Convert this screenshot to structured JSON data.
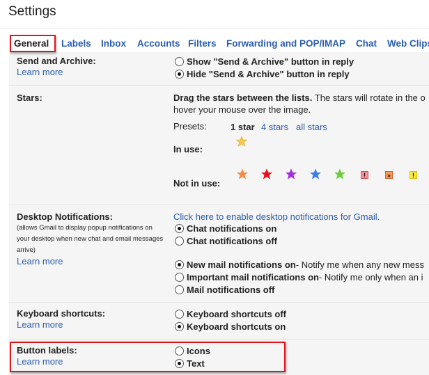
{
  "header": {
    "title": "Settings"
  },
  "tabs": [
    {
      "label": "General",
      "active": true
    },
    {
      "label": "Labels"
    },
    {
      "label": "Inbox"
    },
    {
      "label": "Accounts"
    },
    {
      "label": "Filters"
    },
    {
      "label": "Forwarding and POP/IMAP"
    },
    {
      "label": "Chat"
    },
    {
      "label": "Web Clips"
    }
  ],
  "common": {
    "learn_more": "Learn more"
  },
  "send_archive": {
    "label": "Send and Archive:",
    "options": [
      {
        "label": "Show \"Send & Archive\" button in reply",
        "checked": false
      },
      {
        "label": "Hide \"Send & Archive\" button in reply",
        "checked": true
      }
    ]
  },
  "stars": {
    "label": "Stars:",
    "instruction_bold": "Drag the stars between the lists.",
    "instruction_rest": " The stars will rotate in the o",
    "instruction_line2": "hover your mouse over the image.",
    "presets_label": "Presets:",
    "presets": [
      {
        "label": "1 star",
        "selected": true
      },
      {
        "label": "4 stars"
      },
      {
        "label": "all stars"
      }
    ],
    "in_use_label": "In use:",
    "in_use": [
      {
        "name": "yellow-star",
        "color": "#f7c948"
      }
    ],
    "not_in_use_label": "Not in use:",
    "not_in_use": [
      {
        "name": "orange-star",
        "type": "star",
        "color": "#f68b45"
      },
      {
        "name": "red-star",
        "type": "star",
        "color": "#e8101a"
      },
      {
        "name": "purple-star",
        "type": "star",
        "color": "#a22ce0"
      },
      {
        "name": "blue-star",
        "type": "star",
        "color": "#3d7ee5"
      },
      {
        "name": "green-star",
        "type": "star",
        "color": "#6ccc3c"
      },
      {
        "name": "red-bang",
        "type": "box",
        "glyph": "!",
        "color": "#f59096",
        "border": "#d9545c"
      },
      {
        "name": "orange-guillemet",
        "type": "box",
        "glyph": "»",
        "color": "#f89a5c",
        "border": "#d0642a"
      },
      {
        "name": "yellow-bang",
        "type": "box",
        "glyph": "!",
        "color": "#fbe83a",
        "border": "#d4c21a"
      }
    ]
  },
  "desktop_notifications": {
    "label": "Desktop Notifications:",
    "description": "(allows Gmail to display popup notifications on your desktop when new chat and email messages arrive)",
    "enable_link": "Click here to enable desktop notifications for Gmail.",
    "chat_options": [
      {
        "label": "Chat notifications on",
        "checked": true
      },
      {
        "label": "Chat notifications off",
        "checked": false
      }
    ],
    "mail_options": [
      {
        "label": "New mail notifications on",
        "desc": " - Notify me when any new mess",
        "checked": true
      },
      {
        "label": "Important mail notifications on",
        "desc": " - Notify me only when an i",
        "checked": false
      },
      {
        "label": "Mail notifications off",
        "desc": "",
        "checked": false
      }
    ]
  },
  "keyboard_shortcuts": {
    "label": "Keyboard shortcuts:",
    "options": [
      {
        "label": "Keyboard shortcuts off",
        "checked": false
      },
      {
        "label": "Keyboard shortcuts on",
        "checked": true
      }
    ]
  },
  "button_labels": {
    "label": "Button labels:",
    "options": [
      {
        "label": "Icons",
        "checked": false
      },
      {
        "label": "Text",
        "checked": true
      }
    ]
  },
  "colors": {
    "link": "#2a5db0",
    "highlight": "#e0141c",
    "panel_bg": "#f5f5f5"
  }
}
